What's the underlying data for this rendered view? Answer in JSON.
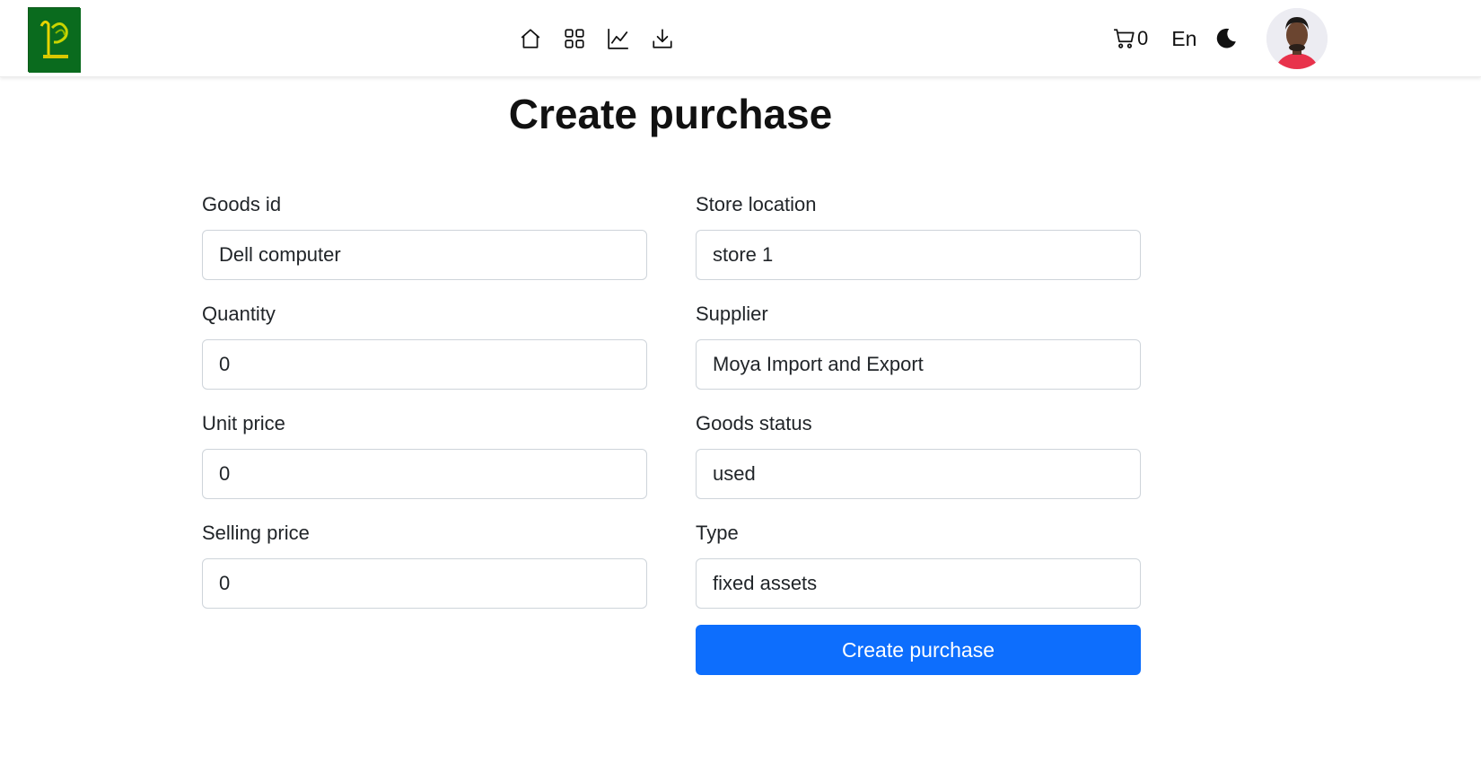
{
  "header": {
    "nav_icons": [
      "home-icon",
      "grid-icon",
      "chart-line-icon",
      "download-icon"
    ],
    "cart_count": "0",
    "language": "En"
  },
  "page": {
    "title": "Create purchase"
  },
  "form": {
    "goods_id": {
      "label": "Goods id",
      "value": "Dell computer"
    },
    "quantity": {
      "label": "Quantity",
      "value": "0"
    },
    "unit_price": {
      "label": "Unit price",
      "value": "0"
    },
    "selling_price": {
      "label": "Selling price",
      "value": "0"
    },
    "store_location": {
      "label": "Store location",
      "value": "store 1"
    },
    "supplier": {
      "label": "Supplier",
      "value": "Moya Import and Export"
    },
    "goods_status": {
      "label": "Goods status",
      "value": "used"
    },
    "type": {
      "label": "Type",
      "value": "fixed assets"
    },
    "submit_label": "Create purchase"
  },
  "colors": {
    "primary": "#0d6efd",
    "logo_bg": "#0a6b1e",
    "avatar_shirt": "#e8324b"
  }
}
